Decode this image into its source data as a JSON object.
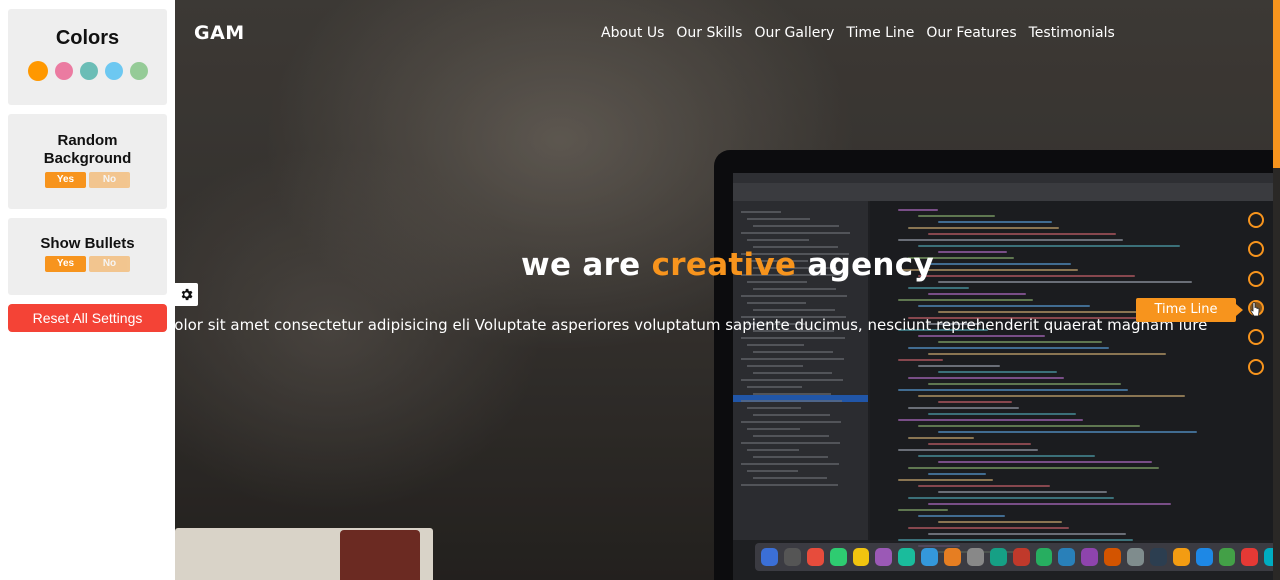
{
  "settings": {
    "colors_title": "Colors",
    "swatches": [
      {
        "color": "#ff9800",
        "active": true
      },
      {
        "color": "#e91e63"
      },
      {
        "color": "#009688"
      },
      {
        "color": "#03a9f4"
      },
      {
        "color": "#4caf50"
      }
    ],
    "random_background": {
      "title": "Random Background",
      "yes": "Yes",
      "no": "No"
    },
    "show_bullets": {
      "title": "Show Bullets",
      "yes": "Yes",
      "no": "No"
    },
    "reset_label": "Reset All Settings",
    "toggle_icon": "gear-icon"
  },
  "header": {
    "logo": "GAM",
    "nav": [
      "About Us",
      "Our Skills",
      "Our Gallery",
      "Time Line",
      "Our Features",
      "Testimonials"
    ]
  },
  "hero": {
    "headline_pre": "we are",
    "headline_accent": "creative",
    "headline_post": "agency",
    "tagline": "Lorem ipsum dolor sit amet consectetur adipisicing eli Voluptate asperiores voluptatum sapiente ducimus, nesciunt reprehenderit quaerat magnam iure"
  },
  "bullets": {
    "count": 6,
    "active_index": 3,
    "tooltip": "Time Line"
  },
  "theme": {
    "accent": "#f7941d",
    "reset": "#f44336"
  }
}
